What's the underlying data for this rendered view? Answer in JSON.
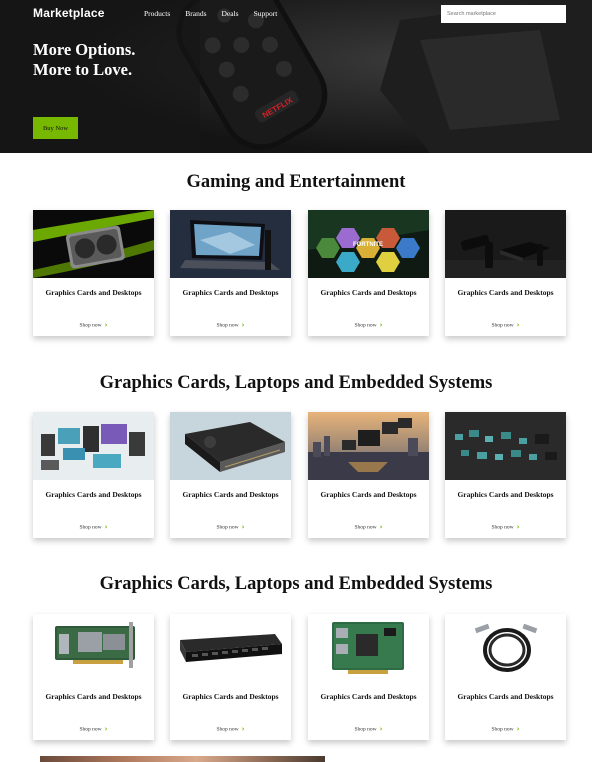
{
  "header": {
    "brand": "Marketplace",
    "nav": [
      "Products",
      "Brands",
      "Deals",
      "Support"
    ],
    "search_placeholder": "Search marketplace"
  },
  "hero": {
    "line1": "More Options.",
    "line2": "More to Love.",
    "button": "Buy Now",
    "remote_badge": "NETFLIX"
  },
  "sections": [
    {
      "title": "Gaming and Entertainment",
      "cards": [
        {
          "title": "Graphics Cards and Desktops",
          "link": "Shop now",
          "image": "graphics-card"
        },
        {
          "title": "Graphics Cards and Desktops",
          "link": "Shop now",
          "image": "gaming-laptop"
        },
        {
          "title": "Graphics Cards and Desktops",
          "link": "Shop now",
          "image": "game-collage",
          "art_text": "FORTNITE"
        },
        {
          "title": "Graphics Cards and Desktops",
          "link": "Shop now",
          "image": "streaming-devices"
        }
      ]
    },
    {
      "title": "Graphics Cards, Laptops and Embedded Systems",
      "cards": [
        {
          "title": "Graphics Cards and Desktops",
          "link": "Shop now",
          "image": "workstations"
        },
        {
          "title": "Graphics Cards and Desktops",
          "link": "Shop now",
          "image": "pro-gpu"
        },
        {
          "title": "Graphics Cards and Desktops",
          "link": "Shop now",
          "image": "city-robotics"
        },
        {
          "title": "Graphics Cards and Desktops",
          "link": "Shop now",
          "image": "embedded-modules"
        }
      ]
    },
    {
      "title": "Graphics Cards, Laptops and Embedded Systems",
      "cards": [
        {
          "title": "Graphics Cards and Desktops",
          "link": "Shop now",
          "image": "network-adapter"
        },
        {
          "title": "Graphics Cards and Desktops",
          "link": "Shop now",
          "image": "network-switch"
        },
        {
          "title": "Graphics Cards and Desktops",
          "link": "Shop now",
          "image": "dpu-card"
        },
        {
          "title": "Graphics Cards and Desktops",
          "link": "Shop now",
          "image": "cable"
        }
      ]
    }
  ],
  "colors": {
    "accent": "#76b900",
    "hero_bg": "#222222",
    "page_bg": "#ffffff"
  }
}
